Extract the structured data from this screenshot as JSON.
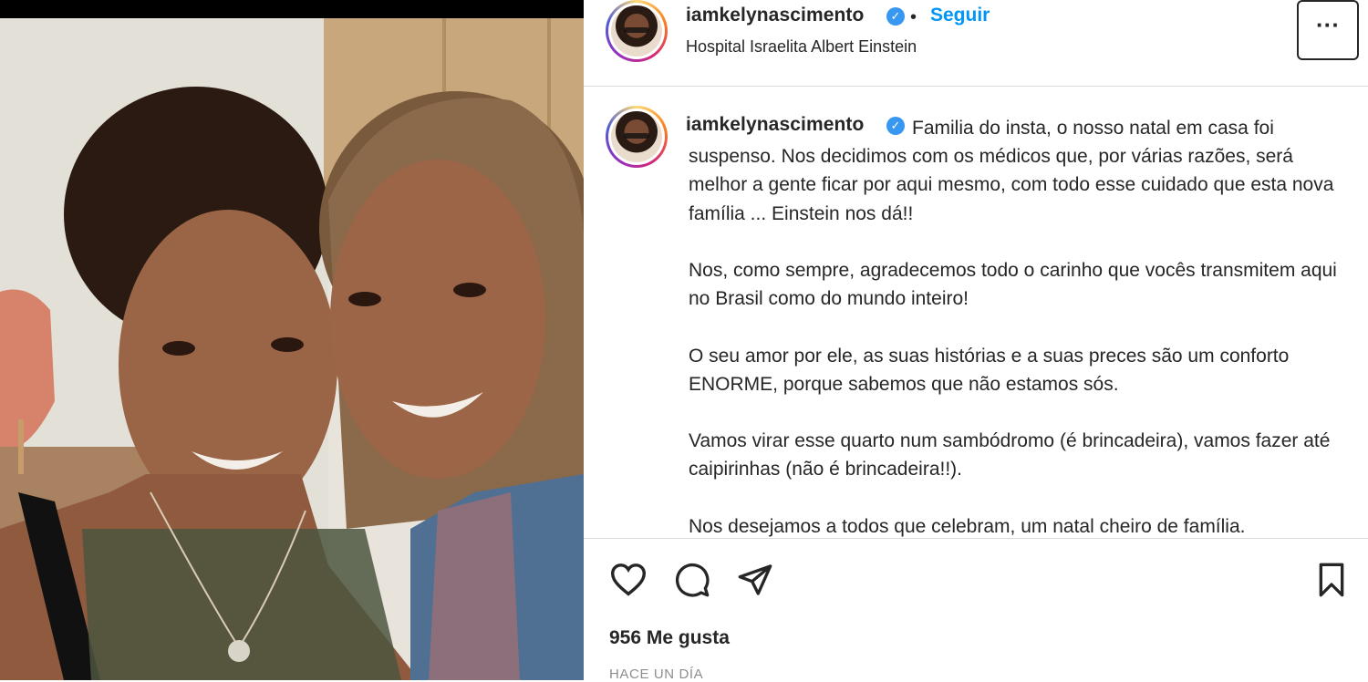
{
  "post": {
    "username": "iamkelynascimento",
    "verified_icon": "verified-badge-icon",
    "separator": "•",
    "follow_label": "Seguir",
    "location": "Hospital Israelita Albert Einstein",
    "more_label": "···",
    "caption": {
      "username": "iamkelynascimento",
      "paragraphs": [
        "Familia do insta, o nosso natal em casa foi suspenso. Nos decidimos com os médicos que, por várias razões, será melhor a gente ficar por aqui mesmo, com todo esse cuidado que esta nova família ... Einstein nos dá!!",
        "Nos, como sempre, agradecemos todo o carinho que vocês transmitem aqui no Brasil como do mundo inteiro!",
        "O seu amor por ele, as suas histórias e a suas preces são um conforto ENORME, porque sabemos que não estamos sós.",
        "Vamos virar esse quarto num sambódromo (é brincadeira), vamos fazer até caipirinhas (não é brincadeira!!).",
        "Nos desejamos a todos que celebram, um natal cheiro de família."
      ]
    },
    "actions": {
      "like_icon": "heart-icon",
      "comment_icon": "comment-icon",
      "share_icon": "paper-plane-icon",
      "save_icon": "bookmark-icon"
    },
    "likes": "956 Me gusta",
    "timestamp": "HACE UN DÍA"
  },
  "colors": {
    "accent": "#0095f6",
    "verified": "#3897f0",
    "text": "#262626",
    "muted": "#8e8e8e",
    "divider": "#dbdbdb"
  }
}
